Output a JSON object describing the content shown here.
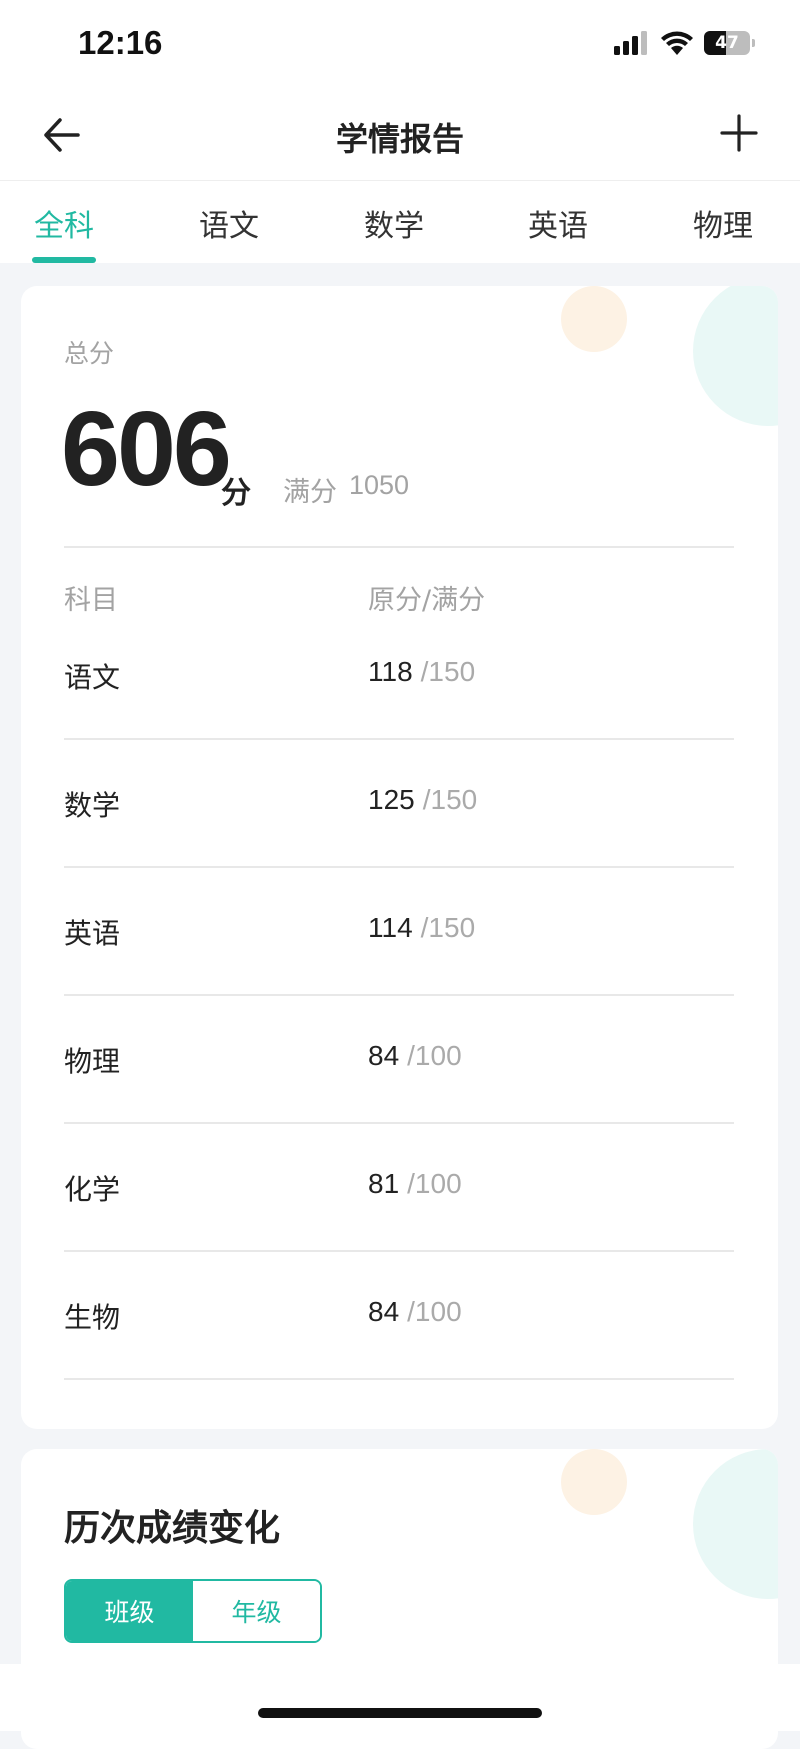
{
  "status_bar": {
    "time": "12:16",
    "battery": "47",
    "battery_level": 0.47
  },
  "nav": {
    "title": "学情报告",
    "back_icon": "arrow-left-icon",
    "add_icon": "plus-icon"
  },
  "tabs": [
    {
      "label": "全科",
      "active": true
    },
    {
      "label": "语文",
      "active": false
    },
    {
      "label": "数学",
      "active": false
    },
    {
      "label": "英语",
      "active": false
    },
    {
      "label": "物理",
      "active": false
    }
  ],
  "summary": {
    "total_label": "总分",
    "total_value": "606",
    "total_unit": "分",
    "full_label": "满分",
    "full_value": "1050"
  },
  "table": {
    "headers": {
      "subject": "科目",
      "score": "原分/满分"
    },
    "rows": [
      {
        "subject": "语文",
        "score": "118",
        "full": "/150"
      },
      {
        "subject": "数学",
        "score": "125",
        "full": "/150"
      },
      {
        "subject": "英语",
        "score": "114",
        "full": "/150"
      },
      {
        "subject": "物理",
        "score": "84",
        "full": "/100"
      },
      {
        "subject": "化学",
        "score": "81",
        "full": "/100"
      },
      {
        "subject": "生物",
        "score": "84",
        "full": "/100"
      }
    ]
  },
  "history": {
    "title": "历次成绩变化",
    "toggle": [
      {
        "label": "班级",
        "selected": true
      },
      {
        "label": "年级",
        "selected": false
      }
    ]
  },
  "colors": {
    "accent": "#21b9a2",
    "muted": "#a3a3a3",
    "background": "#f3f5f8"
  }
}
